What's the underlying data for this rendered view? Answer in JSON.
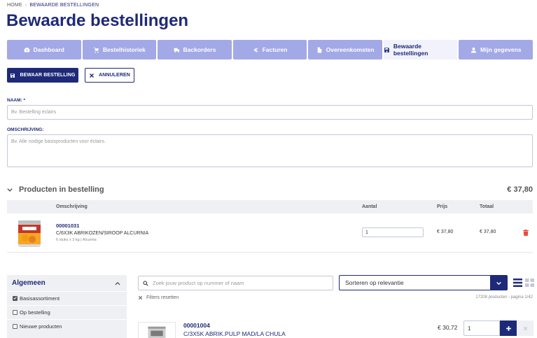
{
  "breadcrumb": {
    "home": "HOME",
    "separator": "›",
    "current": "BEWAARDE BESTELLINGEN"
  },
  "page_title": "Bewaarde bestellingen",
  "tabs": [
    {
      "label": "Dashboard",
      "icon": "dashboard-icon"
    },
    {
      "label": "Bestelhistoriek",
      "icon": "cart-icon"
    },
    {
      "label": "Backorders",
      "icon": "truck-icon"
    },
    {
      "label": "Facturen",
      "icon": "euro-icon"
    },
    {
      "label": "Overeenkomsten",
      "icon": "document-icon"
    },
    {
      "label": "Bewaarde bestellingen",
      "icon": "save-icon",
      "active": true
    },
    {
      "label": "Mijn gegevens",
      "icon": "user-icon"
    }
  ],
  "actions": {
    "save": "BEWAAR BESTELLING",
    "cancel": "ANNULEREN"
  },
  "form": {
    "name_label": "NAAM: *",
    "name_placeholder": "Bv. Bestelling éclairs",
    "description_label": "OMSCHRIJVING:",
    "description_placeholder": "Bv. Alle nodige basisproducten voor éclairs."
  },
  "order": {
    "heading": "Producten in bestelling",
    "total": "€ 37,80",
    "columns": {
      "description": "Omschrijving",
      "quantity": "Aantal",
      "price": "Prijs",
      "total": "Totaal"
    },
    "items": [
      {
        "code": "00001031",
        "name": "C/6X3K ABRIKOZEN/SIROOP ALCURNIA",
        "meta": "6 stuks x 3 kg | Alcurnia",
        "quantity": "1",
        "price": "€ 37,80",
        "total": "€ 37,80"
      }
    ]
  },
  "filters": {
    "heading": "Algemeen",
    "items": [
      {
        "label": "Basisassortiment",
        "checked": true
      },
      {
        "label": "Op bestelling",
        "checked": false
      },
      {
        "label": "Nieuwe producten",
        "checked": false
      }
    ]
  },
  "catalog": {
    "search_placeholder": "Zoek jouw product op nummer of naam",
    "sort_value": "Sorteren op relevantie",
    "reset_label": "Filters resetten",
    "count_text": "17208 producten - pagina 1/42",
    "products": [
      {
        "code": "00001004",
        "name": "C/3X5K ABRIK.PULP MAD/LA CHULA",
        "price": "€ 30,72",
        "quantity": "1"
      }
    ]
  },
  "colors": {
    "primary": "#1e2a78",
    "tab_inactive": "#a3a8e6",
    "tab_active": "#f1f2fb",
    "danger": "#e74c3c",
    "panel": "#eef0f4"
  }
}
